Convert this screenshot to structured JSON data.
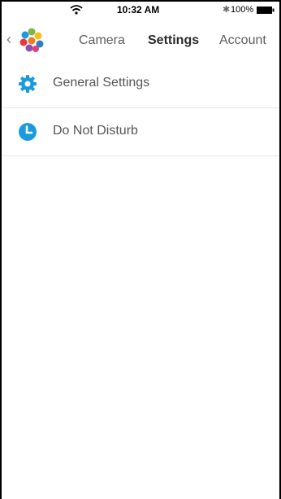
{
  "status_bar": {
    "time": "10:32 AM",
    "battery": "100%",
    "wifi_icon": "wifi-icon",
    "bluetooth_icon": "bluetooth-icon",
    "battery_icon": "battery-icon"
  },
  "nav": {
    "back_icon": "chevron-left-icon",
    "logo": "app-logo",
    "tabs": [
      {
        "label": "Camera",
        "active": false
      },
      {
        "label": "Settings",
        "active": true
      },
      {
        "label": "Account",
        "active": false
      }
    ]
  },
  "settings_list": [
    {
      "label": "General Settings",
      "icon": "gear-icon"
    },
    {
      "label": "Do Not Disturb",
      "icon": "clock-icon"
    }
  ],
  "colors": {
    "accent": "#1a9be0",
    "divider": "#e6e6e6",
    "text": "#555555",
    "active_tab": "#2b2b2b"
  }
}
